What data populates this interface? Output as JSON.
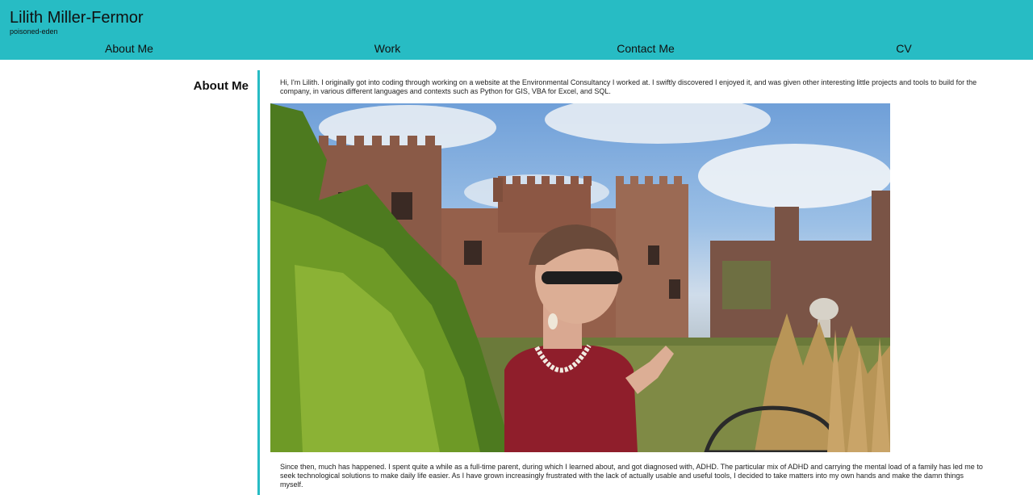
{
  "header": {
    "title": "Lilith Miller-Fermor",
    "subtitle": "poisoned-eden"
  },
  "nav": {
    "items": [
      {
        "label": "About Me"
      },
      {
        "label": "Work"
      },
      {
        "label": "Contact Me"
      },
      {
        "label": "CV"
      }
    ]
  },
  "section": {
    "heading": "About Me",
    "intro": "Hi, I'm Lilith. I originally got into coding through working on a website at the Environmental Consultancy I worked at. I swiftly discovered I enjoyed it, and was given other interesting little projects and tools to build for the company, in various different languages and contexts such as Python for GIS, VBA for Excel, and SQL.",
    "more": "Since then, much has happened. I spent quite a while as a full-time parent, during which I learned about, and got diagnosed with, ADHD. The particular mix of ADHD and carrying the mental load of a family has led me to seek technological solutions to make daily life easier. As I have grown increasingly frustrated with the lack of actually usable and useful tools, I decided to take matters into my own hands and make the damn things myself."
  },
  "theme": {
    "accent": "#27bcc4",
    "background": "#ffffff",
    "text": "#101010"
  }
}
